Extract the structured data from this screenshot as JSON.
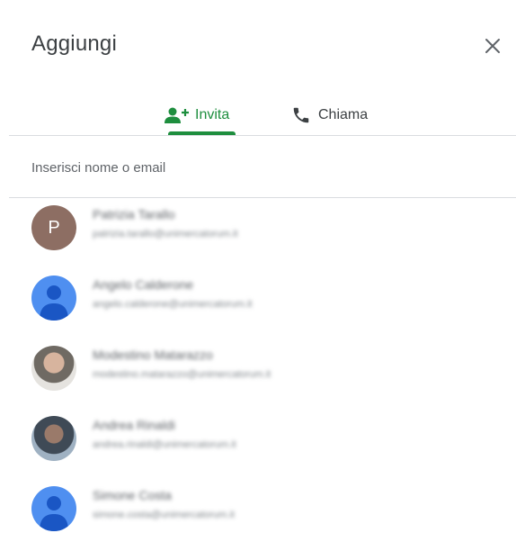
{
  "dialog": {
    "title": "Aggiungi",
    "close_icon": "close-icon"
  },
  "tabs": [
    {
      "label": "Invita",
      "icon": "person-add-icon",
      "active": true,
      "color": "#1e8e3e"
    },
    {
      "label": "Chiama",
      "icon": "phone-icon",
      "active": false
    }
  ],
  "search": {
    "placeholder": "Inserisci nome o email"
  },
  "contacts": [
    {
      "name": "Patrizia Tarallo",
      "email": "patrizia.tarallo@unimercatorum.it",
      "avatar": "letter",
      "initial": "P",
      "avatar_color": "#8d6e63"
    },
    {
      "name": "Angelo Calderone",
      "email": "angelo.calderone@unimercatorum.it",
      "avatar": "generic-person-icon",
      "avatar_color": "#4f8ff0"
    },
    {
      "name": "Modestino Matarazzo",
      "email": "modestino.matarazzo@unimercatorum.it",
      "avatar": "photo"
    },
    {
      "name": "Andrea Rinaldi",
      "email": "andrea.rinaldi@unimercatorum.it",
      "avatar": "photo"
    },
    {
      "name": "Simone Costa",
      "email": "simone.costa@unimercatorum.it",
      "avatar": "generic-person-icon",
      "avatar_color": "#4f8ff0"
    }
  ]
}
